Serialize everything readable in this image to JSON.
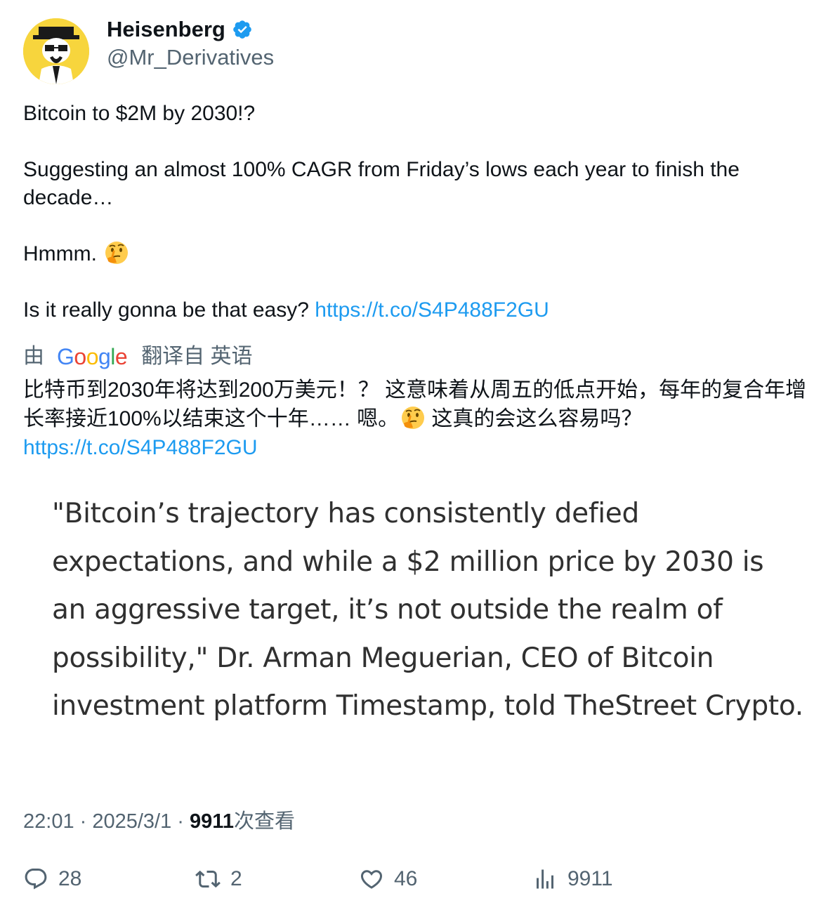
{
  "author": {
    "display_name": "Heisenberg",
    "handle": "@Mr_Derivatives",
    "verified": true
  },
  "tweet": {
    "line1": "Bitcoin to $2M by 2030!?",
    "line2": "Suggesting an almost 100% CAGR from Friday’s lows each year to finish the decade…",
    "line3": "Hmmm.",
    "line3_emoji": "thinking-face-emoji",
    "line4": "Is it really gonna be that easy?",
    "link": "https://t.co/S4P488F2GU"
  },
  "translation": {
    "by_label": "由",
    "provider": "Google",
    "from_label": "翻译自 英语",
    "text_part1": "比特币到2030年将达到200万美元！？ 这意味着从周五的低点开始，每年的复合年增长率接近100%以结束这个十年…… 嗯。",
    "text_emoji": "thinking-face-emoji",
    "text_part2": " 这真的会这么容易吗？",
    "link": "https://t.co/S4P488F2GU"
  },
  "quote_image": {
    "text": "\"Bitcoin’s trajectory has consistently defied expectations, and while a $2 million price by 2030 is an aggressive target, it’s not outside the realm of possibility,\" Dr. Arman Meguerian, CEO of Bitcoin investment platform Timestamp, told TheStreet Crypto."
  },
  "meta": {
    "time": "22:01",
    "separator": " · ",
    "date": "2025/3/1",
    "views_count": "9911",
    "views_label": "次查看"
  },
  "actions": {
    "reply_count": "28",
    "retweet_count": "2",
    "like_count": "46",
    "views_count": "9911",
    "icons": [
      "reply-icon",
      "retweet-icon",
      "like-icon",
      "analytics-icon"
    ]
  },
  "colors": {
    "link": "#1d9bf0",
    "secondary_text": "#536471",
    "primary_text": "#0f1419",
    "verified_badge": "#1d9bf0",
    "avatar_bg": "#f7d53d"
  }
}
